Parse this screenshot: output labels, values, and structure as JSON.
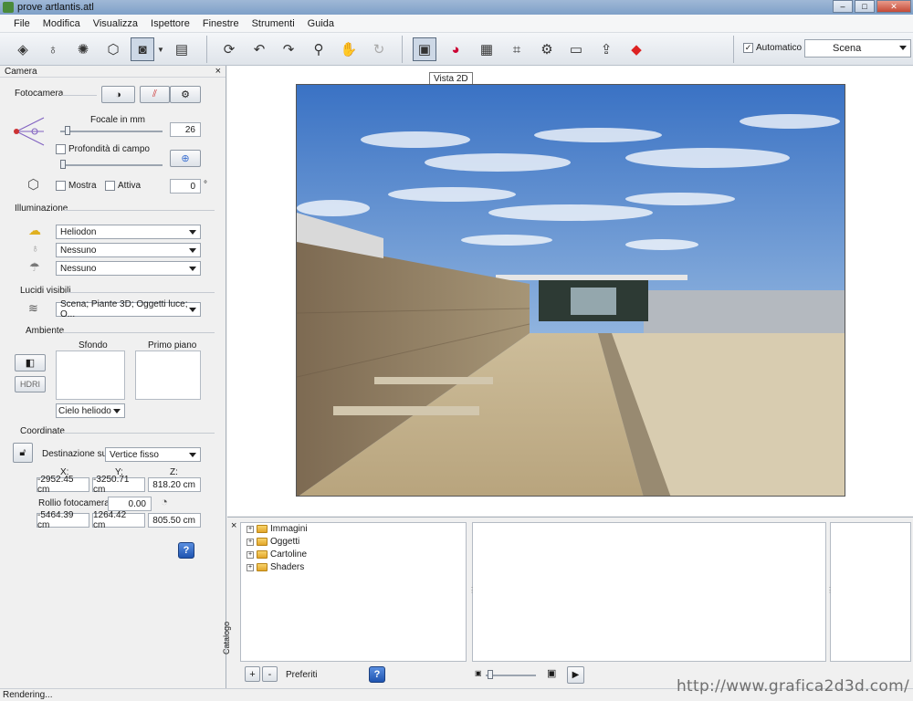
{
  "window": {
    "title": "prove artlantis.atl",
    "buttons": {
      "minimize": "–",
      "maximize": "□",
      "close": "✕"
    }
  },
  "menu": [
    "File",
    "Modifica",
    "Visualizza",
    "Ispettore",
    "Finestre",
    "Strumenti",
    "Guida"
  ],
  "toolbar": {
    "automatic_label": "Automatico",
    "automatic_checked": true,
    "scene_value": "Scena",
    "tooltip": "Vista 2D"
  },
  "camera_panel": {
    "title": "Camera",
    "fotocamera": "Fotocamera",
    "focal_label": "Focale in mm",
    "focal_value": "26",
    "depth_label": "Profondità di campo",
    "mostra_label": "Mostra",
    "attiva_label": "Attiva",
    "angle_value": "0",
    "angle_unit": "°",
    "illuminazione": "Illuminazione",
    "light_selects": [
      "Heliodon",
      "Nessuno",
      "Nessuno"
    ],
    "lucidi": "Lucidi visibili",
    "lucidi_value": "Scena; Piante 3D; Oggetti luce; O...",
    "ambiente": "Ambiente",
    "sfondo": "Sfondo",
    "primo_piano": "Primo piano",
    "hdri": "HDRI",
    "sky_select": "Cielo heliodonica",
    "coordinate": "Coordinate",
    "destinazione_label": "Destinazione su:",
    "destinazione_value": "Vertice fisso",
    "axis_labels": [
      "X:",
      "Y:",
      "Z:"
    ],
    "position": [
      "-2952.45 cm",
      "-3250.71 cm",
      "818.20 cm"
    ],
    "roll_label": "Rollio fotocamera:",
    "roll_value": "0.00",
    "target": [
      "-5464.39 cm",
      "1264.42 cm",
      "805.50 cm"
    ]
  },
  "catalog": {
    "side_label": "Catalogo",
    "tree": [
      "Immagini",
      "Oggetti",
      "Cartoline",
      "Shaders"
    ],
    "add": "+",
    "remove": "-",
    "preferiti": "Preferiti"
  },
  "status": "Rendering...",
  "watermark": "http://www.grafica2d3d.com/"
}
